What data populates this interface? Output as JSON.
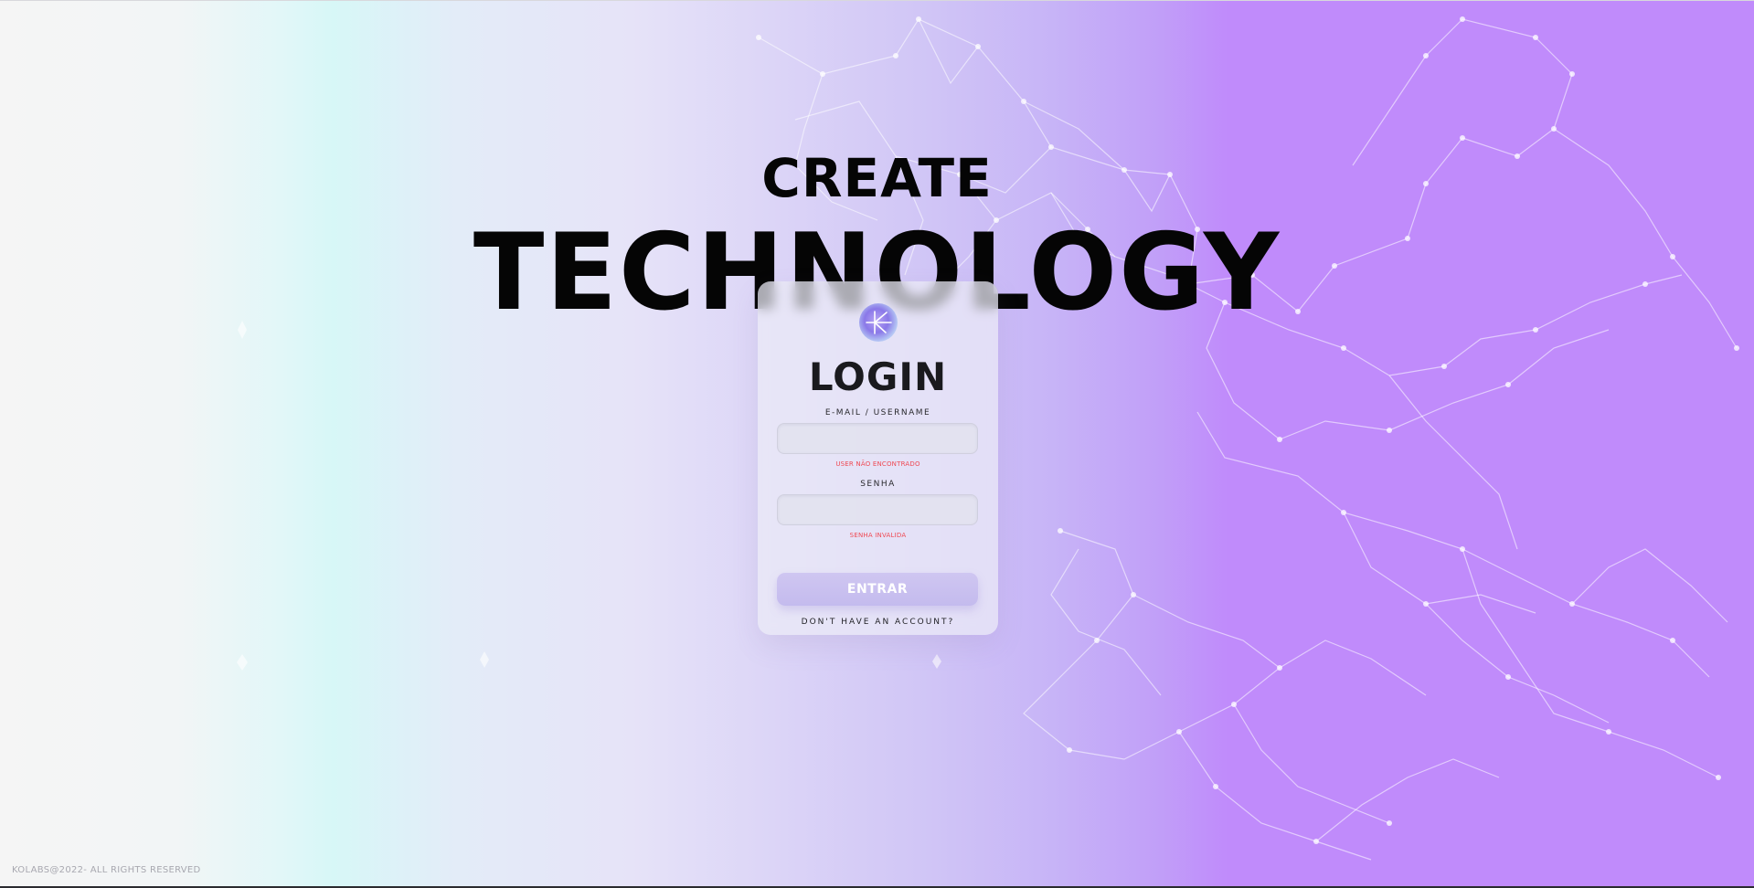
{
  "hero": {
    "line1": "CREATE",
    "line2": "TECHNOLOGY"
  },
  "login": {
    "logo_icon": "k-logo-icon",
    "title": "LOGIN",
    "email_label": "E-MAIL / USERNAME",
    "email_value": "",
    "email_error": "USER NÃO ENCONTRADO",
    "password_label": "SENHA",
    "password_value": "",
    "password_error": "SENHA INVALIDA",
    "submit_label": "ENTRAR",
    "signup_link": "DON'T HAVE AN ACCOUNT?"
  },
  "footer": {
    "copyright": "KOLABS@2022- ALL RIGHTS RESERVED"
  },
  "colors": {
    "error": "#ef4a54",
    "button": "#c9c0f0",
    "accent_purple": "#c08bfb",
    "accent_cyan": "#d7f7f7"
  }
}
